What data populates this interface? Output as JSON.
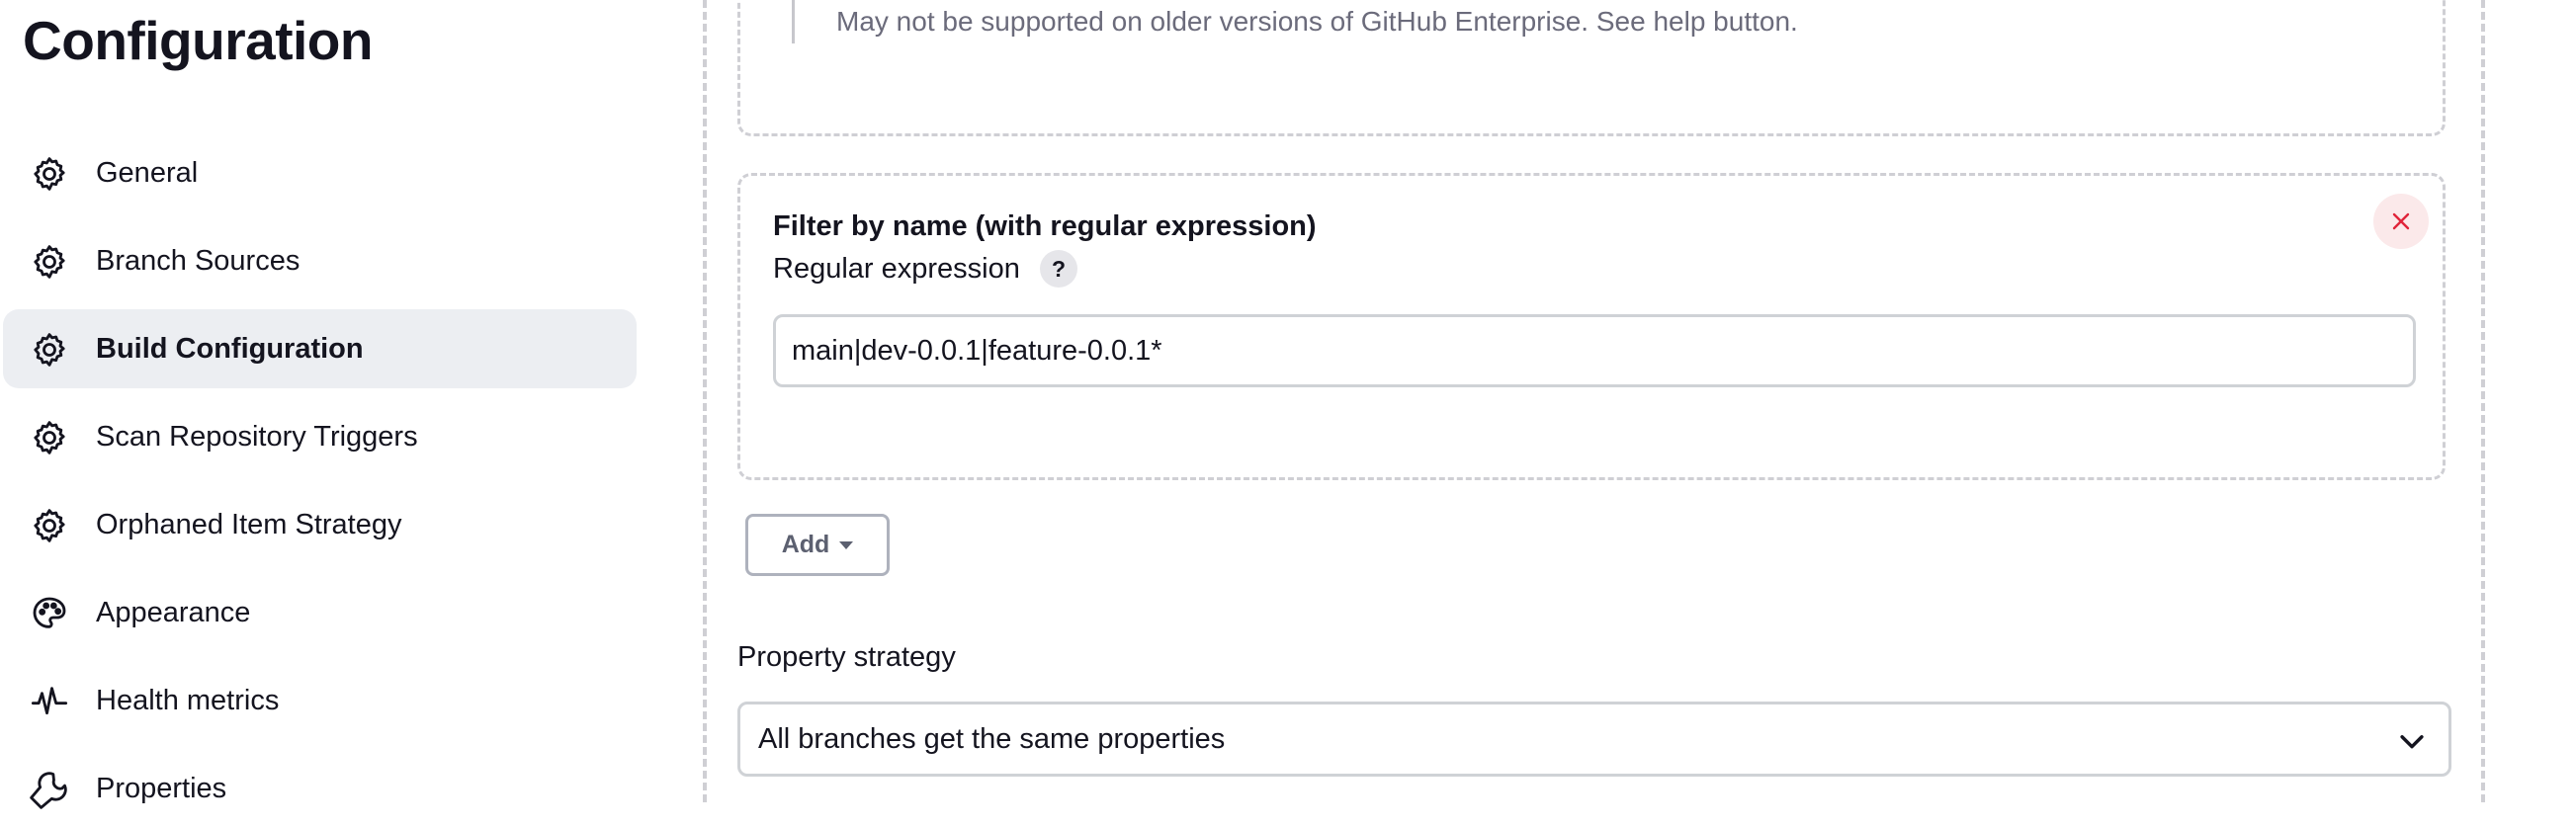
{
  "page": {
    "title": "Configuration"
  },
  "sidebar": {
    "items": [
      {
        "label": "General",
        "icon": "gear-icon",
        "active": false
      },
      {
        "label": "Branch Sources",
        "icon": "gear-icon",
        "active": false
      },
      {
        "label": "Build Configuration",
        "icon": "gear-icon",
        "active": true
      },
      {
        "label": "Scan Repository Triggers",
        "icon": "gear-icon",
        "active": false
      },
      {
        "label": "Orphaned Item Strategy",
        "icon": "gear-icon",
        "active": false
      },
      {
        "label": "Appearance",
        "icon": "palette-icon",
        "active": false
      },
      {
        "label": "Health metrics",
        "icon": "pulse-icon",
        "active": false
      },
      {
        "label": "Properties",
        "icon": "wrench-icon",
        "active": false
      }
    ]
  },
  "main": {
    "help_text": "May not be supported on older versions of GitHub Enterprise. See help button.",
    "filter": {
      "title": "Filter by name (with regular expression)",
      "regex_label": "Regular expression",
      "help_label": "?",
      "regex_value": "main|dev-0.0.1|feature-0.0.1*"
    },
    "add_button_label": "Add",
    "property_strategy": {
      "label": "Property strategy",
      "selected": "All branches get the same properties"
    }
  },
  "colors": {
    "accent_active_bg": "#eceef2",
    "close_button_bg": "#fbe9ea",
    "close_icon": "#e0243a",
    "dashed_border": "#cfcfd4"
  }
}
